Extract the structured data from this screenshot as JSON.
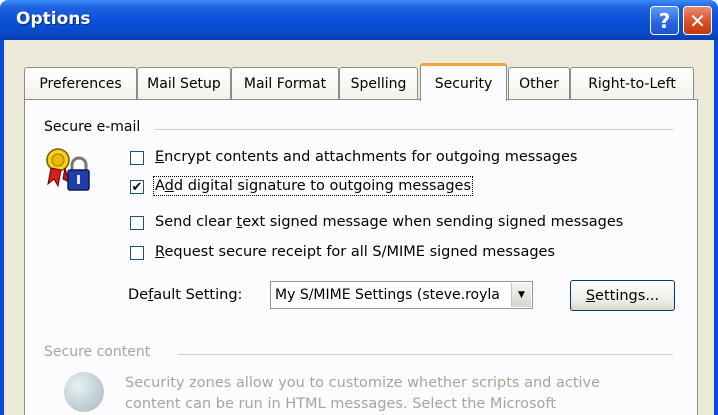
{
  "window": {
    "title": "Options",
    "help_glyph": "?",
    "close_glyph": "✕"
  },
  "tabs": [
    {
      "label": "Preferences",
      "active": false
    },
    {
      "label": "Mail Setup",
      "active": false
    },
    {
      "label": "Mail Format",
      "active": false
    },
    {
      "label": "Spelling",
      "active": false
    },
    {
      "label": "Security",
      "active": true
    },
    {
      "label": "Other",
      "active": false
    },
    {
      "label": "Right-to-Left",
      "active": false
    }
  ],
  "secure_email": {
    "group_label": "Secure e-mail",
    "icon": "security-certificate-lock-icon",
    "options": [
      {
        "pre": "",
        "accel": "E",
        "post": "ncrypt contents and attachments for outgoing messages",
        "checked": false
      },
      {
        "pre": "A",
        "accel": "d",
        "post": "d digital signature to outgoing messages",
        "checked": true
      },
      {
        "pre": "Send clear ",
        "accel": "t",
        "post": "ext signed message when sending signed messages",
        "checked": false
      },
      {
        "pre": "",
        "accel": "R",
        "post": "equest secure receipt for all S/MIME signed messages",
        "checked": false
      }
    ],
    "default_setting": {
      "label_pre": "De",
      "label_accel": "f",
      "label_post": "ault Setting:",
      "value": "My S/MIME Settings (steve.royla",
      "arrow": "▼"
    },
    "settings_button": {
      "accel": "S",
      "post": "ettings..."
    }
  },
  "secure_content": {
    "group_label": "Secure content",
    "icon": "globe-icon",
    "text_line1": "Security zones allow you to customize whether scripts and active",
    "text_line2": "content can be run in HTML messages.  Select the Microsoft"
  },
  "check_mark": "✔"
}
